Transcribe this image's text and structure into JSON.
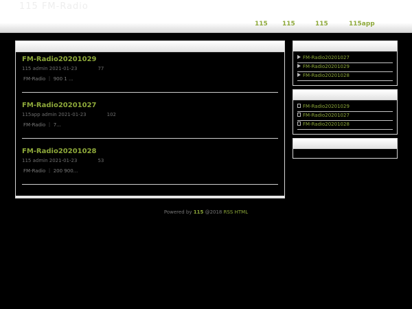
{
  "header": {
    "logo_text": "115 FM-Radio",
    "nav": [
      "115",
      "115",
      "115",
      "115app"
    ]
  },
  "posts": [
    {
      "title": "FM-Radio20201029",
      "author": "115 admin",
      "date": "2021-01-23",
      "count": "77",
      "excerpt": "FM-Radio ｜ 900 1 ..."
    },
    {
      "title": "FM-Radio20201027",
      "author": "115app admin",
      "date": "2021-01-23",
      "count": "102",
      "excerpt": "FM-Radio ｜ 7..."
    },
    {
      "title": "FM-Radio20201028",
      "author": "115 admin",
      "date": "2021-01-23",
      "count": "53",
      "excerpt": "FM-Radio ｜ 200 900..."
    }
  ],
  "sidebar": {
    "recent": [
      "FM-Radio20201027",
      "FM-Radio20201029",
      "FM-Radio20201028"
    ],
    "popular": [
      "FM-Radio20201029",
      "FM-Radio20201027",
      "FM-Radio20201028"
    ]
  },
  "footer": {
    "powered_by": "Powered by",
    "brand": "115",
    "copyright": "@2018",
    "rss": "RSS",
    "html": "HTML"
  },
  "colors": {
    "accent": "#8ea93a",
    "background": "#000000"
  }
}
